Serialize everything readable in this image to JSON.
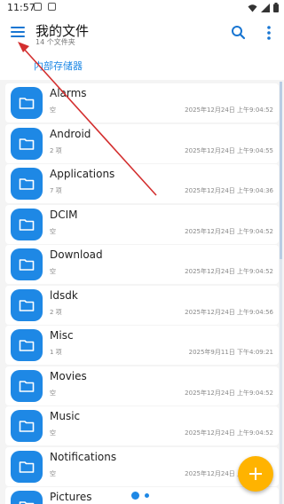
{
  "status_bar": {
    "time": "11:57",
    "icons": [
      "notification-icon",
      "notification-icon",
      "wifi-icon",
      "signal-icon",
      "battery-icon"
    ]
  },
  "app_bar": {
    "title": "我的文件",
    "subtitle": "14 个文件夹",
    "menu_icon": "menu-icon",
    "search_icon": "search-icon",
    "more_icon": "more-vertical-icon"
  },
  "breadcrumb": {
    "label": "内部存储器"
  },
  "files": [
    {
      "name": "Alarms",
      "count": "空",
      "date": "2025年12月24日 上午9:04:52"
    },
    {
      "name": "Android",
      "count": "2 项",
      "date": "2025年12月24日 上午9:04:55"
    },
    {
      "name": "Applications",
      "count": "7 项",
      "date": "2025年12月24日 上午9:04:36"
    },
    {
      "name": "DCIM",
      "count": "空",
      "date": "2025年12月24日 上午9:04:52"
    },
    {
      "name": "Download",
      "count": "空",
      "date": "2025年12月24日 上午9:04:52"
    },
    {
      "name": "ldsdk",
      "count": "2 项",
      "date": "2025年12月24日 上午9:04:56"
    },
    {
      "name": "Misc",
      "count": "1 项",
      "date": "2025年9月11日 下午4:09:21"
    },
    {
      "name": "Movies",
      "count": "空",
      "date": "2025年12月24日 上午9:04:52"
    },
    {
      "name": "Music",
      "count": "空",
      "date": "2025年12月24日 上午9:04:52"
    },
    {
      "name": "Notifications",
      "count": "空",
      "date": "2025年12月24日 上午9:04:52"
    },
    {
      "name": "Pictures",
      "count": "",
      "date": ""
    }
  ],
  "fab": {
    "icon": "plus-icon"
  },
  "colors": {
    "accent": "#1e88e5",
    "fab": "#ffb300",
    "annotation_arrow": "#d32f2f"
  }
}
